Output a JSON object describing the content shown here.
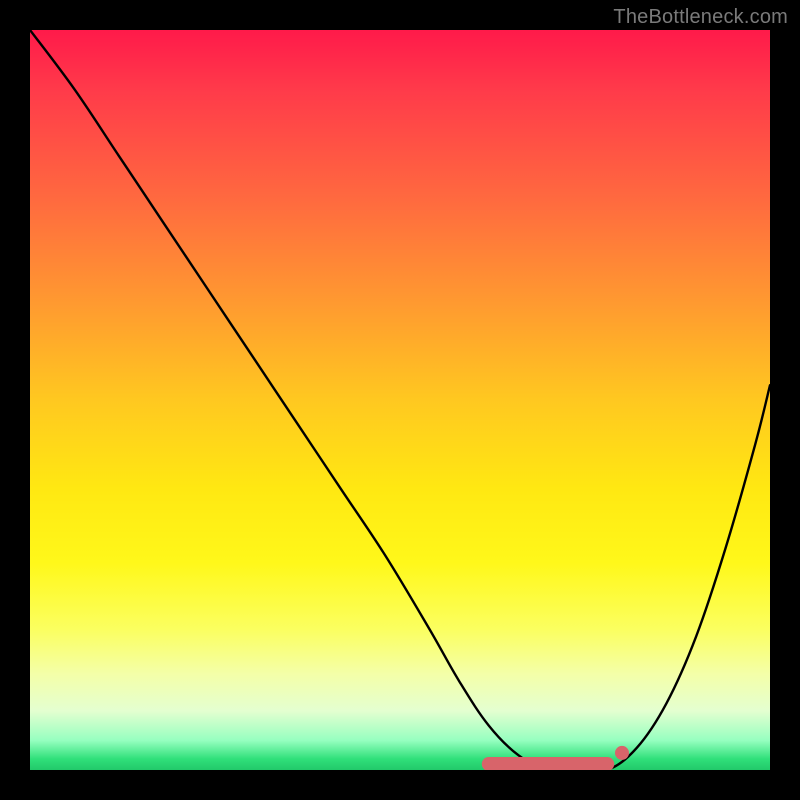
{
  "watermark": "TheBottleneck.com",
  "chart_data": {
    "type": "line",
    "title": "",
    "xlabel": "",
    "ylabel": "",
    "xlim": [
      0,
      100
    ],
    "ylim": [
      0,
      100
    ],
    "series": [
      {
        "name": "bottleneck-curve",
        "x": [
          0,
          6,
          12,
          18,
          24,
          30,
          36,
          42,
          48,
          54,
          58,
          62,
          66,
          70,
          74,
          78,
          82,
          86,
          90,
          94,
          98,
          100
        ],
        "y": [
          100,
          92,
          83,
          74,
          65,
          56,
          47,
          38,
          29,
          19,
          12,
          6,
          2,
          0,
          0,
          0,
          3,
          9,
          18,
          30,
          44,
          52
        ]
      }
    ],
    "markers": [
      {
        "name": "flat-segment",
        "x_start": 62,
        "x_end": 78,
        "y": 0,
        "color": "#d8646a"
      },
      {
        "name": "end-dot",
        "x": 80,
        "y": 1.5,
        "color": "#d8646a"
      }
    ],
    "background_gradient": {
      "stops": [
        {
          "pos": 0.0,
          "color": "#ff1a4a"
        },
        {
          "pos": 0.5,
          "color": "#ffc820"
        },
        {
          "pos": 0.8,
          "color": "#fbff60"
        },
        {
          "pos": 0.96,
          "color": "#96ffc0"
        },
        {
          "pos": 1.0,
          "color": "#22c96a"
        }
      ]
    }
  }
}
